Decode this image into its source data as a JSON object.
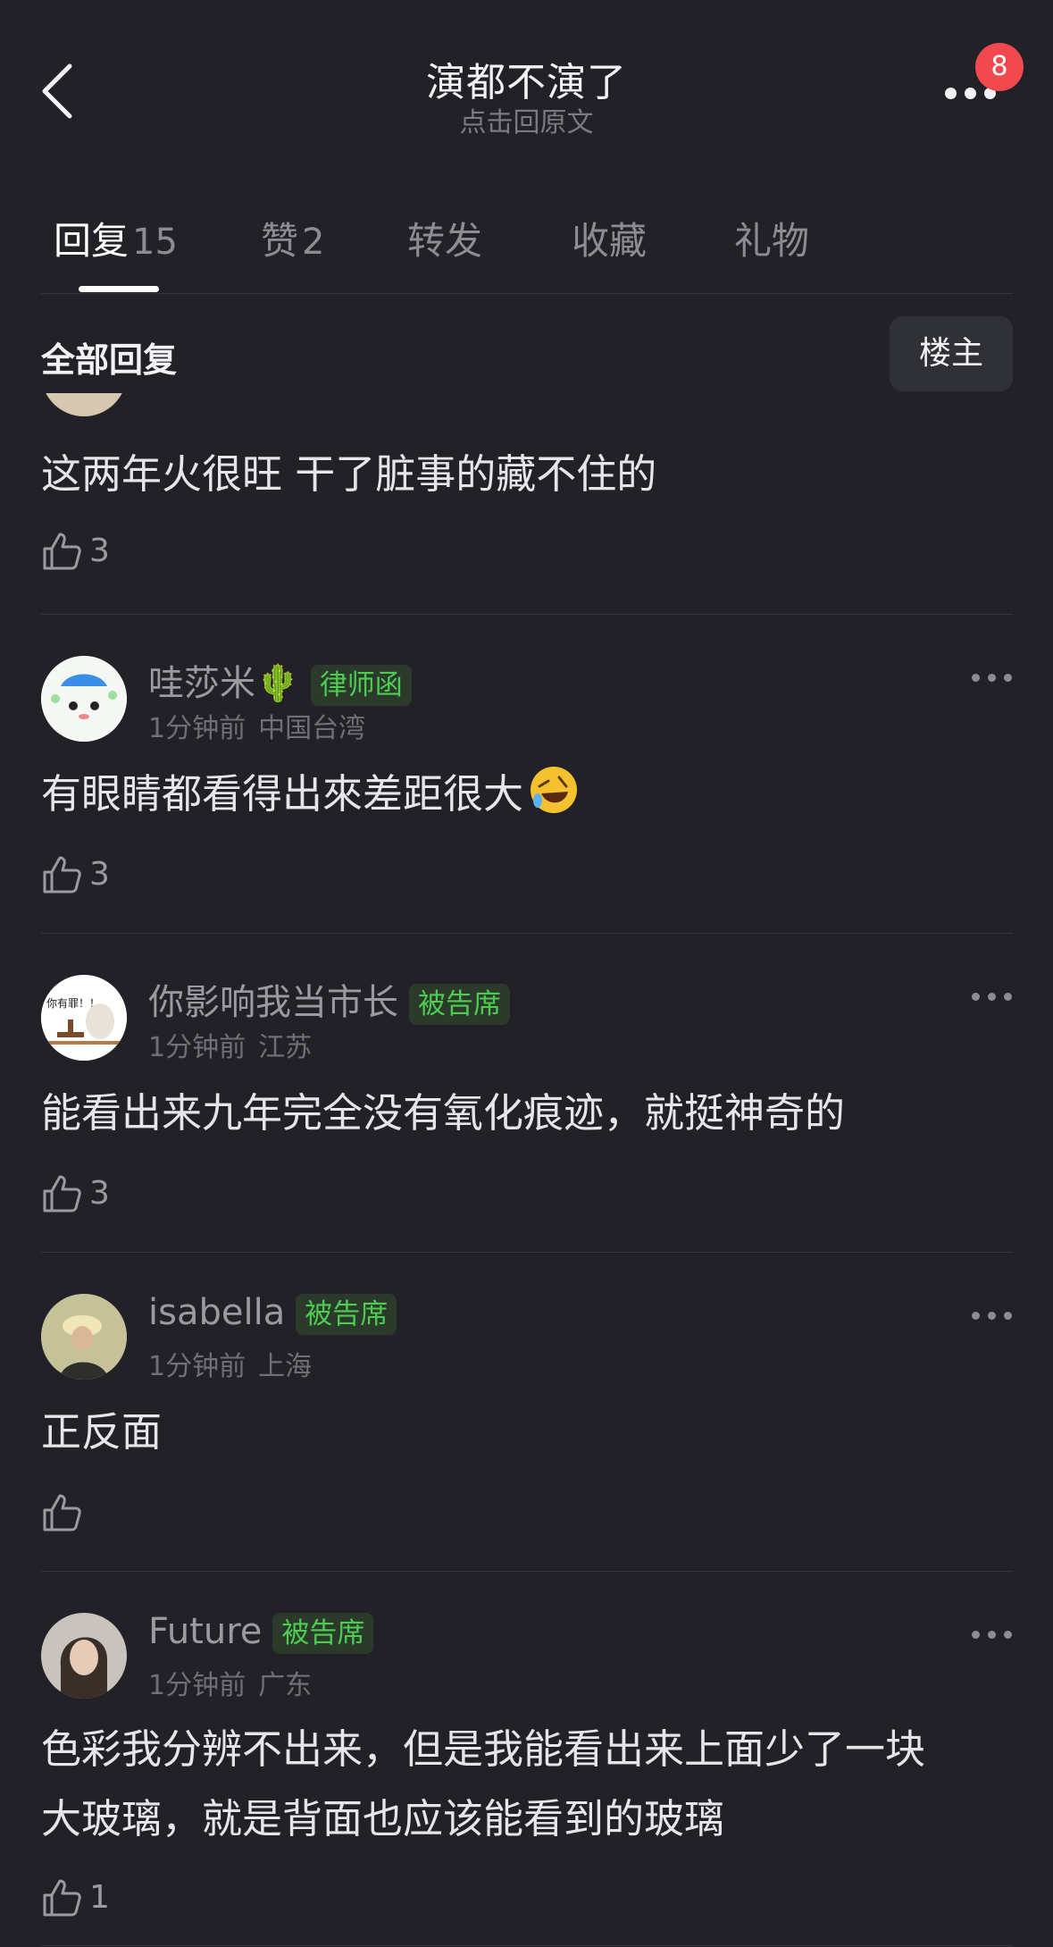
{
  "header": {
    "title": "演都不演了",
    "subtitle": "点击回原文",
    "notification_count": "8"
  },
  "tabs": [
    {
      "label": "回复",
      "count": "15",
      "active": true
    },
    {
      "label": "赞",
      "count": "2",
      "active": false
    },
    {
      "label": "转发",
      "count": "",
      "active": false
    },
    {
      "label": "收藏",
      "count": "",
      "active": false
    },
    {
      "label": "礼物",
      "count": "",
      "active": false
    }
  ],
  "section": {
    "title": "全部回复",
    "filter_label": "楼主"
  },
  "comments": [
    {
      "text": "这两年火很旺 干了脏事的藏不住的",
      "likes": "3"
    },
    {
      "username": "哇莎米🌵",
      "tag": "律师函",
      "time": "1分钟前",
      "location": "中国台湾",
      "text": "有眼睛都看得出來差距很大",
      "likes": "3",
      "avatar_text": ""
    },
    {
      "username": "你影响我当市长",
      "tag": "被告席",
      "time": "1分钟前",
      "location": "江苏",
      "text": "能看出来九年完全没有氧化痕迹，就挺神奇的",
      "likes": "3",
      "avatar_text": "你有罪！！"
    },
    {
      "username": "isabella",
      "tag": "被告席",
      "time": "1分钟前",
      "location": "上海",
      "text": "正反面",
      "likes": ""
    },
    {
      "username": "Future",
      "tag": "被告席",
      "time": "1分钟前",
      "location": "广东",
      "text_line1": "色彩我分辨不出来，但是我能看出来上面少了一块",
      "text_line2": "大玻璃，就是背面也应该能看到的玻璃",
      "likes": "1"
    }
  ],
  "colors": {
    "background": "#212127",
    "tag_green": "#4dcc52",
    "badge_red": "#f04a4f"
  }
}
